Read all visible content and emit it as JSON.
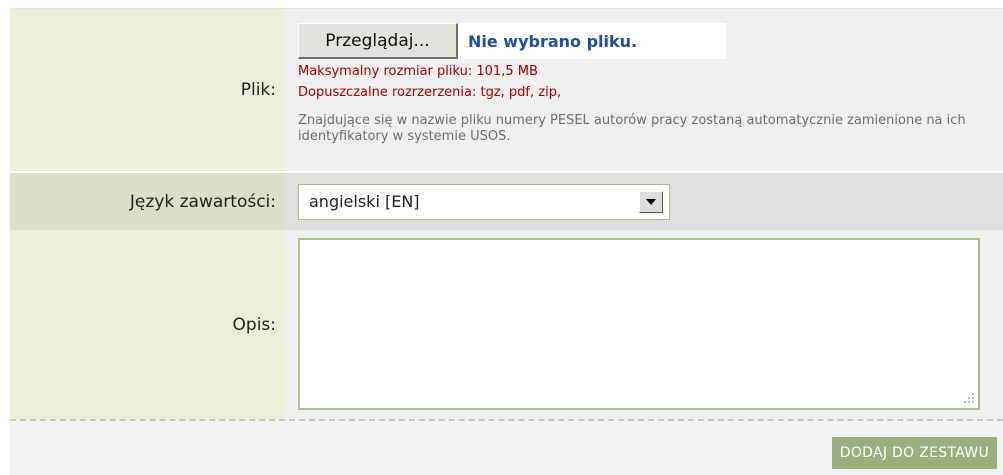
{
  "file_row": {
    "label": "Plik:",
    "browse_button": "Przeglądaj...",
    "file_status": "Nie wybrano pliku.",
    "max_size": "Maksymalny rozmiar pliku: 101,5 MB",
    "allowed_ext": "Dopuszczalne rozrzerzenia: tgz, pdf, zip,",
    "hint": "Znajdujące się w nazwie pliku numery PESEL autorów pracy zostaną automatycznie zamienione na ich identyfikatory w systemie USOS."
  },
  "lang_row": {
    "label": "Język zawartości:",
    "selected": "angielski [EN]"
  },
  "desc_row": {
    "label": "Opis:",
    "value": ""
  },
  "footer": {
    "submit_label": "DODAJ DO ZESTAWU"
  },
  "colors": {
    "limit_text": "#a40000",
    "file_status": "#1f4fa8",
    "submit_bg": "#98b17c",
    "label_bg": "#eaeed7"
  },
  "icons": {
    "select_arrow": "triangle-down",
    "resize_grip": "resize-grip-dots"
  }
}
